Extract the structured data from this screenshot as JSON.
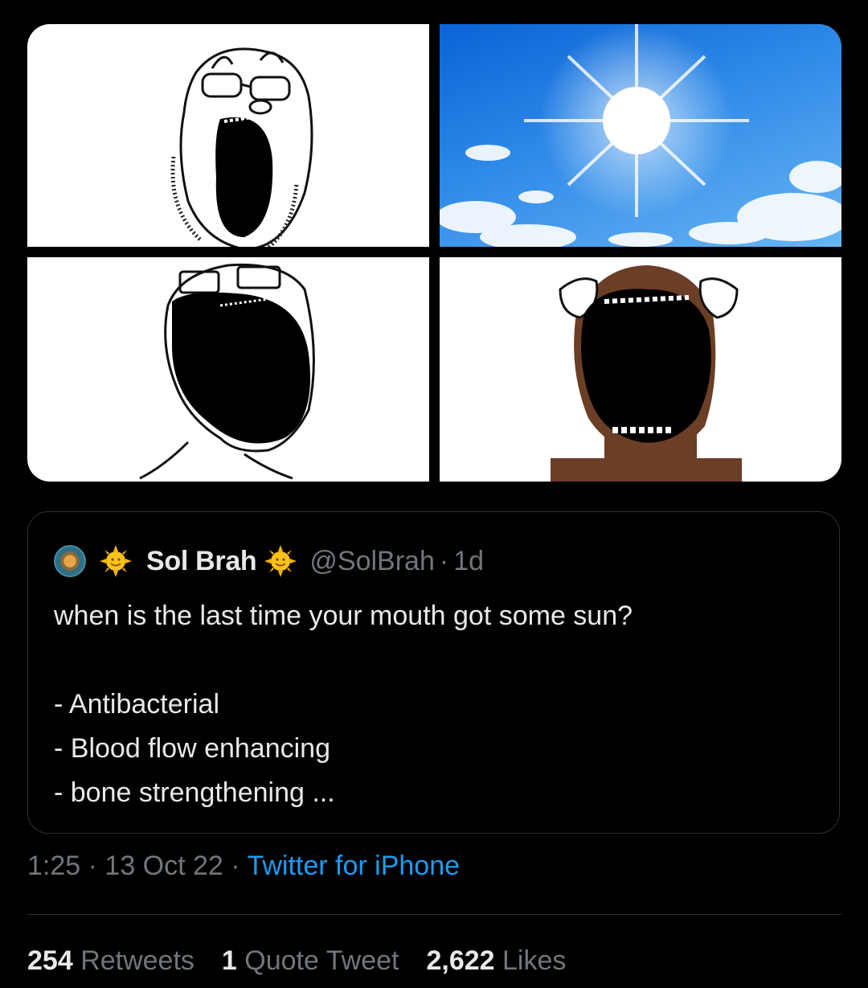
{
  "media": [
    {
      "name": "soyjak-glasses-yelling"
    },
    {
      "name": "sun-in-blue-sky"
    },
    {
      "name": "soyjak-wide-mouth"
    },
    {
      "name": "brown-soyjak-yelling"
    }
  ],
  "quote": {
    "display_name": "Sol Brah",
    "handle": "@SolBrah",
    "separator": "·",
    "age": "1d",
    "text": "when is the last time your mouth got some sun?\n\n- Antibacterial\n- Blood flow enhancing\n- bone strengthening ...",
    "emoji": "sun-with-face-emoji"
  },
  "meta": {
    "time": "1:25",
    "date": "13 Oct 22",
    "separator": "·",
    "source": "Twitter for iPhone"
  },
  "stats": {
    "retweets_count": "254",
    "retweets_label": "Retweets",
    "quotes_count": "1",
    "quotes_label": "Quote Tweet",
    "likes_count": "2,622",
    "likes_label": "Likes"
  },
  "colors": {
    "background": "#000000",
    "text": "#e7e9ea",
    "muted": "#71767b",
    "link": "#1d9bf0",
    "border": "#2f3336"
  }
}
